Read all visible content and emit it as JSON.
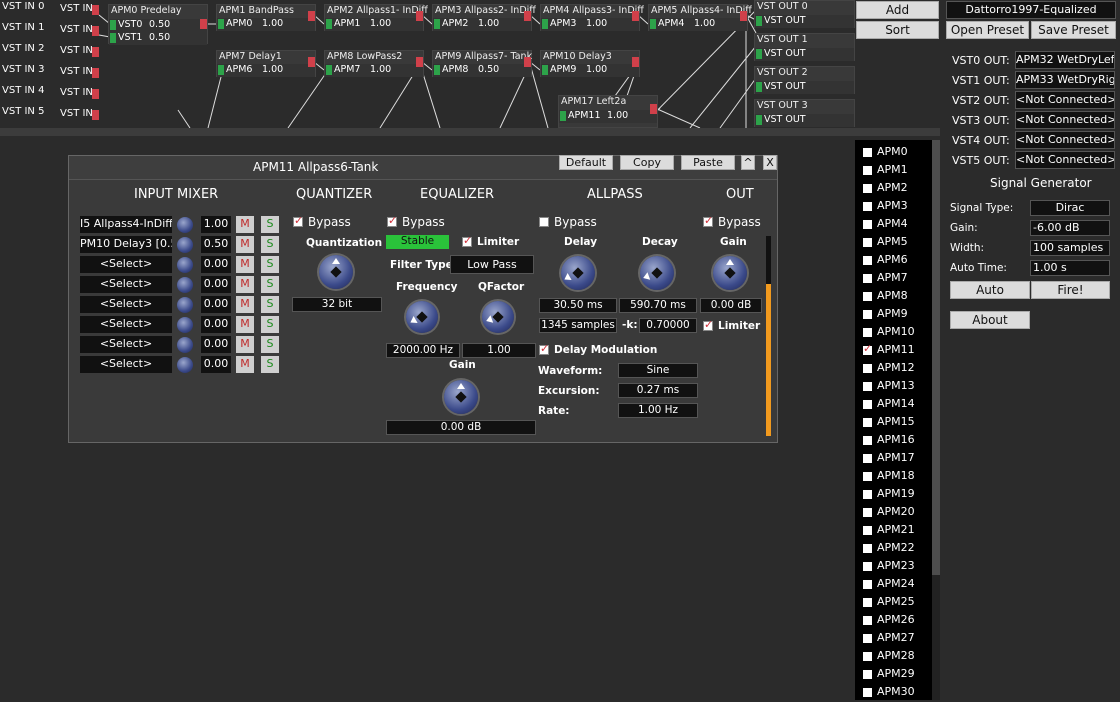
{
  "graph": {
    "vst_in": [
      {
        "name": "VST IN 0",
        "tag": "VST IN"
      },
      {
        "name": "VST IN 1",
        "tag": "VST IN"
      },
      {
        "name": "VST IN 2",
        "tag": "VST IN"
      },
      {
        "name": "VST IN 3",
        "tag": "VST IN"
      },
      {
        "name": "VST IN 4",
        "tag": "VST IN"
      },
      {
        "name": "VST IN 5",
        "tag": "VST IN"
      }
    ],
    "nodes": [
      {
        "title": "APM0 Predelay",
        "rows": [
          {
            "label": "VST0",
            "value": "0.50"
          },
          {
            "label": "VST1",
            "value": "0.50"
          }
        ]
      },
      {
        "title": "APM1 BandPass",
        "rows": [
          {
            "label": "APM0",
            "value": "1.00"
          }
        ]
      },
      {
        "title": "APM2 Allpass1- InDiff",
        "rows": [
          {
            "label": "APM1",
            "value": "1.00"
          }
        ]
      },
      {
        "title": "APM3 Allpass2- InDiff",
        "rows": [
          {
            "label": "APM2",
            "value": "1.00"
          }
        ]
      },
      {
        "title": "APM4 Allpass3- InDiff",
        "rows": [
          {
            "label": "APM3",
            "value": "1.00"
          }
        ]
      },
      {
        "title": "APM5 Allpass4- InDiff",
        "rows": [
          {
            "label": "APM4",
            "value": "1.00"
          }
        ]
      },
      {
        "title": "APM7 Delay1",
        "rows": [
          {
            "label": "APM6",
            "value": "1.00"
          }
        ]
      },
      {
        "title": "APM8 LowPass2",
        "rows": [
          {
            "label": "APM7",
            "value": "1.00"
          }
        ]
      },
      {
        "title": "APM9 Allpass7- Tank",
        "rows": [
          {
            "label": "APM8",
            "value": "0.50"
          }
        ]
      },
      {
        "title": "APM10 Delay3",
        "rows": [
          {
            "label": "APM9",
            "value": "1.00"
          }
        ]
      },
      {
        "title": "APM17 Left2a",
        "rows": [
          {
            "label": "APM11",
            "value": "1.00"
          }
        ]
      }
    ],
    "vst_out": [
      {
        "name": "VST OUT 0",
        "tag": "VST OUT"
      },
      {
        "name": "VST OUT 1",
        "tag": "VST OUT"
      },
      {
        "name": "VST OUT 2",
        "tag": "VST OUT"
      },
      {
        "name": "VST OUT 3",
        "tag": "VST OUT"
      }
    ]
  },
  "toolbar": {
    "add": "Add",
    "sort": "Sort"
  },
  "right": {
    "preset_name": "Dattorro1997-Equalized",
    "open_preset": "Open Preset",
    "save_preset": "Save Preset",
    "outputs": [
      {
        "label": "VST0 OUT:",
        "value": "APM32 WetDryLeft"
      },
      {
        "label": "VST1 OUT:",
        "value": "APM33 WetDryRight"
      },
      {
        "label": "VST2 OUT:",
        "value": "<Not Connected>"
      },
      {
        "label": "VST3 OUT:",
        "value": "<Not Connected>"
      },
      {
        "label": "VST4 OUT:",
        "value": "<Not Connected>"
      },
      {
        "label": "VST5 OUT:",
        "value": "<Not Connected>"
      }
    ],
    "siggen_title": "Signal Generator",
    "siggen": [
      {
        "label": "Signal Type:",
        "value": "Dirac"
      },
      {
        "label": "Gain:",
        "value": "-6.00 dB"
      },
      {
        "label": "Width:",
        "value": "100 samples"
      },
      {
        "label": "Auto Time:",
        "value": "1.00 s"
      }
    ],
    "auto": "Auto",
    "fire": "Fire!",
    "about": "About"
  },
  "apm_list": [
    "APM0",
    "APM1",
    "APM2",
    "APM3",
    "APM4",
    "APM5",
    "APM6",
    "APM7",
    "APM8",
    "APM9",
    "APM10",
    "APM11",
    "APM12",
    "APM13",
    "APM14",
    "APM15",
    "APM16",
    "APM17",
    "APM18",
    "APM19",
    "APM20",
    "APM21",
    "APM22",
    "APM23",
    "APM24",
    "APM25",
    "APM26",
    "APM27",
    "APM28",
    "APM29",
    "APM30"
  ],
  "apm_selected": "APM11",
  "panel": {
    "title": "APM11 Allpass6-Tank",
    "default": "Default",
    "copy": "Copy",
    "paste": "Paste",
    "up": "^",
    "close": "X",
    "input_mixer": {
      "title": "INPUT MIXER",
      "rows": [
        {
          "source": "I5 Allpass4-InDiff [",
          "value": "1.00",
          "m": "M",
          "s": "S"
        },
        {
          "source": "PM10 Delay3 [0.5",
          "value": "0.50",
          "m": "M",
          "s": "S"
        },
        {
          "source": "<Select>",
          "value": "0.00",
          "m": "M",
          "s": "S"
        },
        {
          "source": "<Select>",
          "value": "0.00",
          "m": "M",
          "s": "S"
        },
        {
          "source": "<Select>",
          "value": "0.00",
          "m": "M",
          "s": "S"
        },
        {
          "source": "<Select>",
          "value": "0.00",
          "m": "M",
          "s": "S"
        },
        {
          "source": "<Select>",
          "value": "0.00",
          "m": "M",
          "s": "S"
        },
        {
          "source": "<Select>",
          "value": "0.00",
          "m": "M",
          "s": "S"
        }
      ]
    },
    "quantizer": {
      "title": "QUANTIZER",
      "bypass": "Bypass",
      "quantization": "Quantization",
      "value": "32 bit"
    },
    "equalizer": {
      "title": "EQUALIZER",
      "bypass": "Bypass",
      "stable": "Stable",
      "limiter": "Limiter",
      "filter_type_label": "Filter Type:",
      "filter_type": "Low Pass",
      "frequency": "Frequency",
      "qfactor": "QFactor",
      "frequency_value": "2000.00 Hz",
      "qfactor_value": "1.00",
      "gain": "Gain",
      "gain_value": "0.00 dB"
    },
    "allpass": {
      "title": "ALLPASS",
      "bypass": "Bypass",
      "delay": "Delay",
      "decay": "Decay",
      "delay_value": "30.50 ms",
      "decay_value": "590.70 ms",
      "samples": "1345 samples",
      "k_label": "-k:",
      "k_value": "0.70000",
      "delay_mod": "Delay Modulation",
      "waveform_label": "Waveform:",
      "waveform": "Sine",
      "excursion_label": "Excursion:",
      "excursion": "0.27 ms",
      "rate_label": "Rate:",
      "rate": "1.00 Hz"
    },
    "out": {
      "title": "OUT",
      "bypass": "Bypass",
      "gain": "Gain",
      "gain_value": "0.00 dB",
      "limiter": "Limiter"
    }
  }
}
